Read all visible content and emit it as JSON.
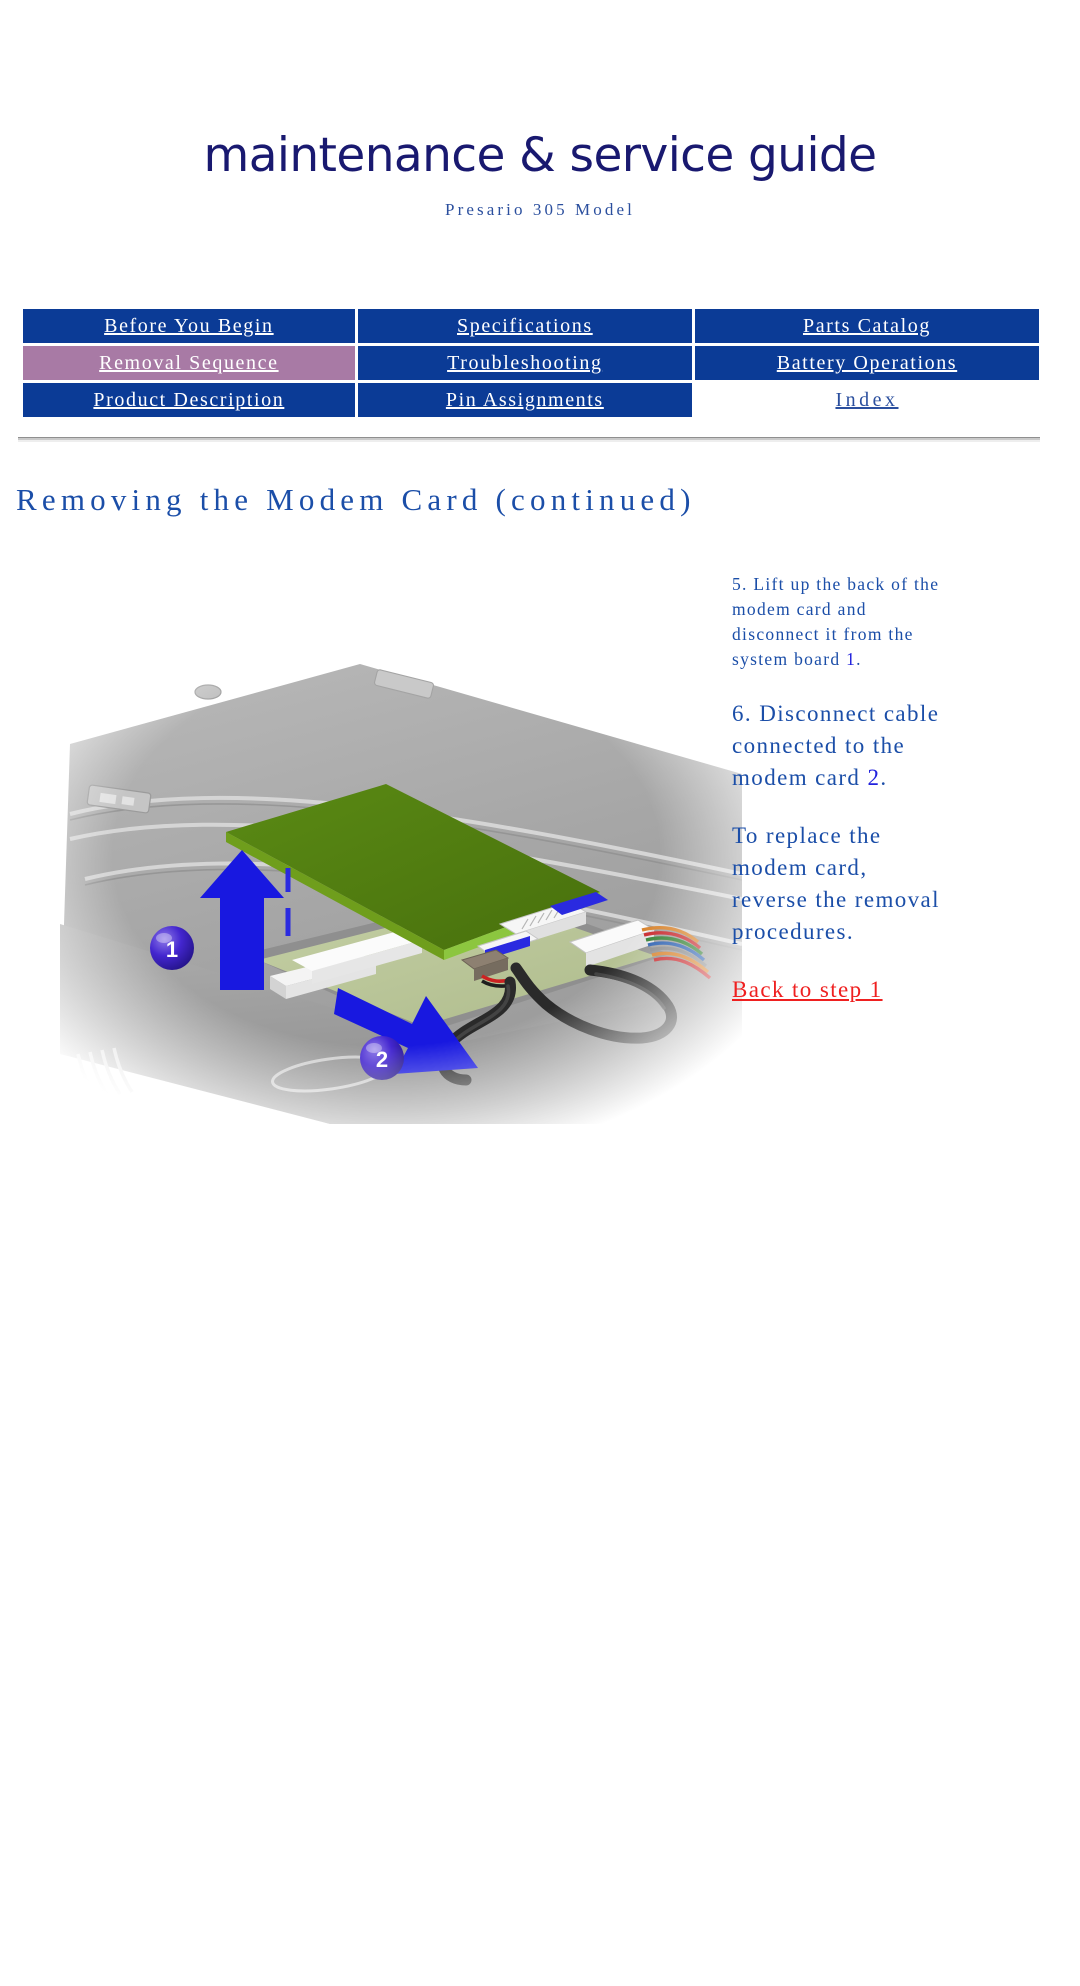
{
  "masthead": {
    "guide_title": "maintenance & service guide",
    "model_subtitle": "Presario 305 Model"
  },
  "nav": {
    "rows": [
      [
        {
          "label": "Before You Begin",
          "state": "link"
        },
        {
          "label": "Specifications",
          "state": "link"
        },
        {
          "label": "Parts Catalog",
          "state": "link"
        }
      ],
      [
        {
          "label": "Removal Sequence",
          "state": "current"
        },
        {
          "label": "Troubleshooting",
          "state": "link"
        },
        {
          "label": "Battery Operations",
          "state": "link"
        }
      ],
      [
        {
          "label": "Product Description",
          "state": "link"
        },
        {
          "label": "Pin Assignments",
          "state": "link"
        },
        {
          "label": "Index",
          "state": "plain"
        }
      ]
    ]
  },
  "page": {
    "title": "Removing the Modem Card (continued)"
  },
  "steps": {
    "step5": {
      "text": "5. Lift up the back of the modem card and disconnect it from the system board ",
      "marker": "1",
      "tail": "."
    },
    "step6": {
      "text": "6. Disconnect cable connected to the modem card ",
      "marker": "2",
      "tail": "."
    },
    "replace_note": "To replace the modem card, reverse the removal procedures.",
    "back_link": "Back to step 1"
  },
  "illustration": {
    "alt": "Exploded view of laptop chassis with modem card being lifted and cable disconnected",
    "callouts": [
      {
        "id": "1",
        "meaning": "lift-modem-card-arrow"
      },
      {
        "id": "2",
        "meaning": "disconnect-cable-arrow"
      }
    ],
    "colors": {
      "chassis_gray": "#a8a8a8",
      "card_green": "#4f7d10",
      "card_edge_green": "#8cc63f",
      "socket_area_green": "#bcc89a",
      "arrow_blue": "#1818e0",
      "callout_sphere": "#3a1fc8",
      "cable_black": "#2a2a2a",
      "connector_white": "#f2f2f2"
    }
  }
}
